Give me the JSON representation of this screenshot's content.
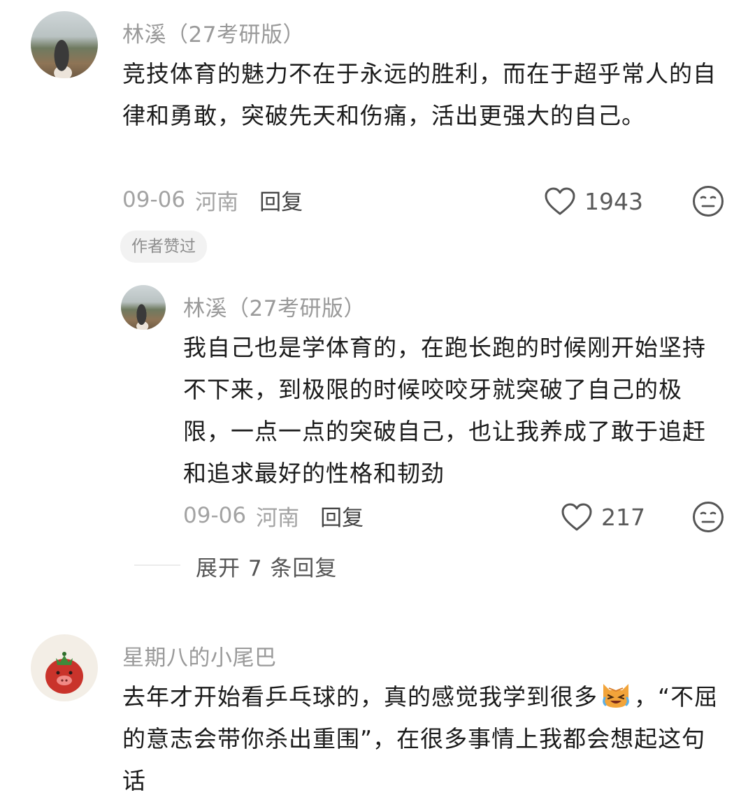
{
  "comments": [
    {
      "author": "林溪（27考研版）",
      "text": "竞技体育的魅力不在于永远的胜利，而在于超乎常人的自律和勇敢，突破先天和伤痛，活出更强大的自己。",
      "date": "09-06",
      "location": "河南",
      "reply_label": "回复",
      "likes": "1943",
      "badge": "作者赞过",
      "replies": [
        {
          "author": "林溪（27考研版）",
          "text": "我自己也是学体育的，在跑长跑的时候刚开始坚持不下来，到极限的时候咬咬牙就突破了自己的极限，一点一点的突破自己，也让我养成了敢于追赶和追求最好的性格和韧劲",
          "date": "09-06",
          "location": "河南",
          "reply_label": "回复",
          "likes": "217"
        }
      ],
      "expand_label": "展开 7 条回复"
    },
    {
      "author": "星期八的小尾巴",
      "text_before_emoji": "去年才开始看乒乓球的，真的感觉我学到很多",
      "emoji": "crying-cat-emoji",
      "text_after_emoji": "，“不屈的意志会带你杀出重围”，在很多事情上我都会想起这句话"
    }
  ],
  "icons": {
    "like": "heart-outline-icon",
    "reaction": "neutral-face-icon"
  },
  "colors": {
    "author": "#9a9a9a",
    "body": "#1b1b1b",
    "meta": "#a3a3a3",
    "badge_bg": "#f2f2f2"
  }
}
